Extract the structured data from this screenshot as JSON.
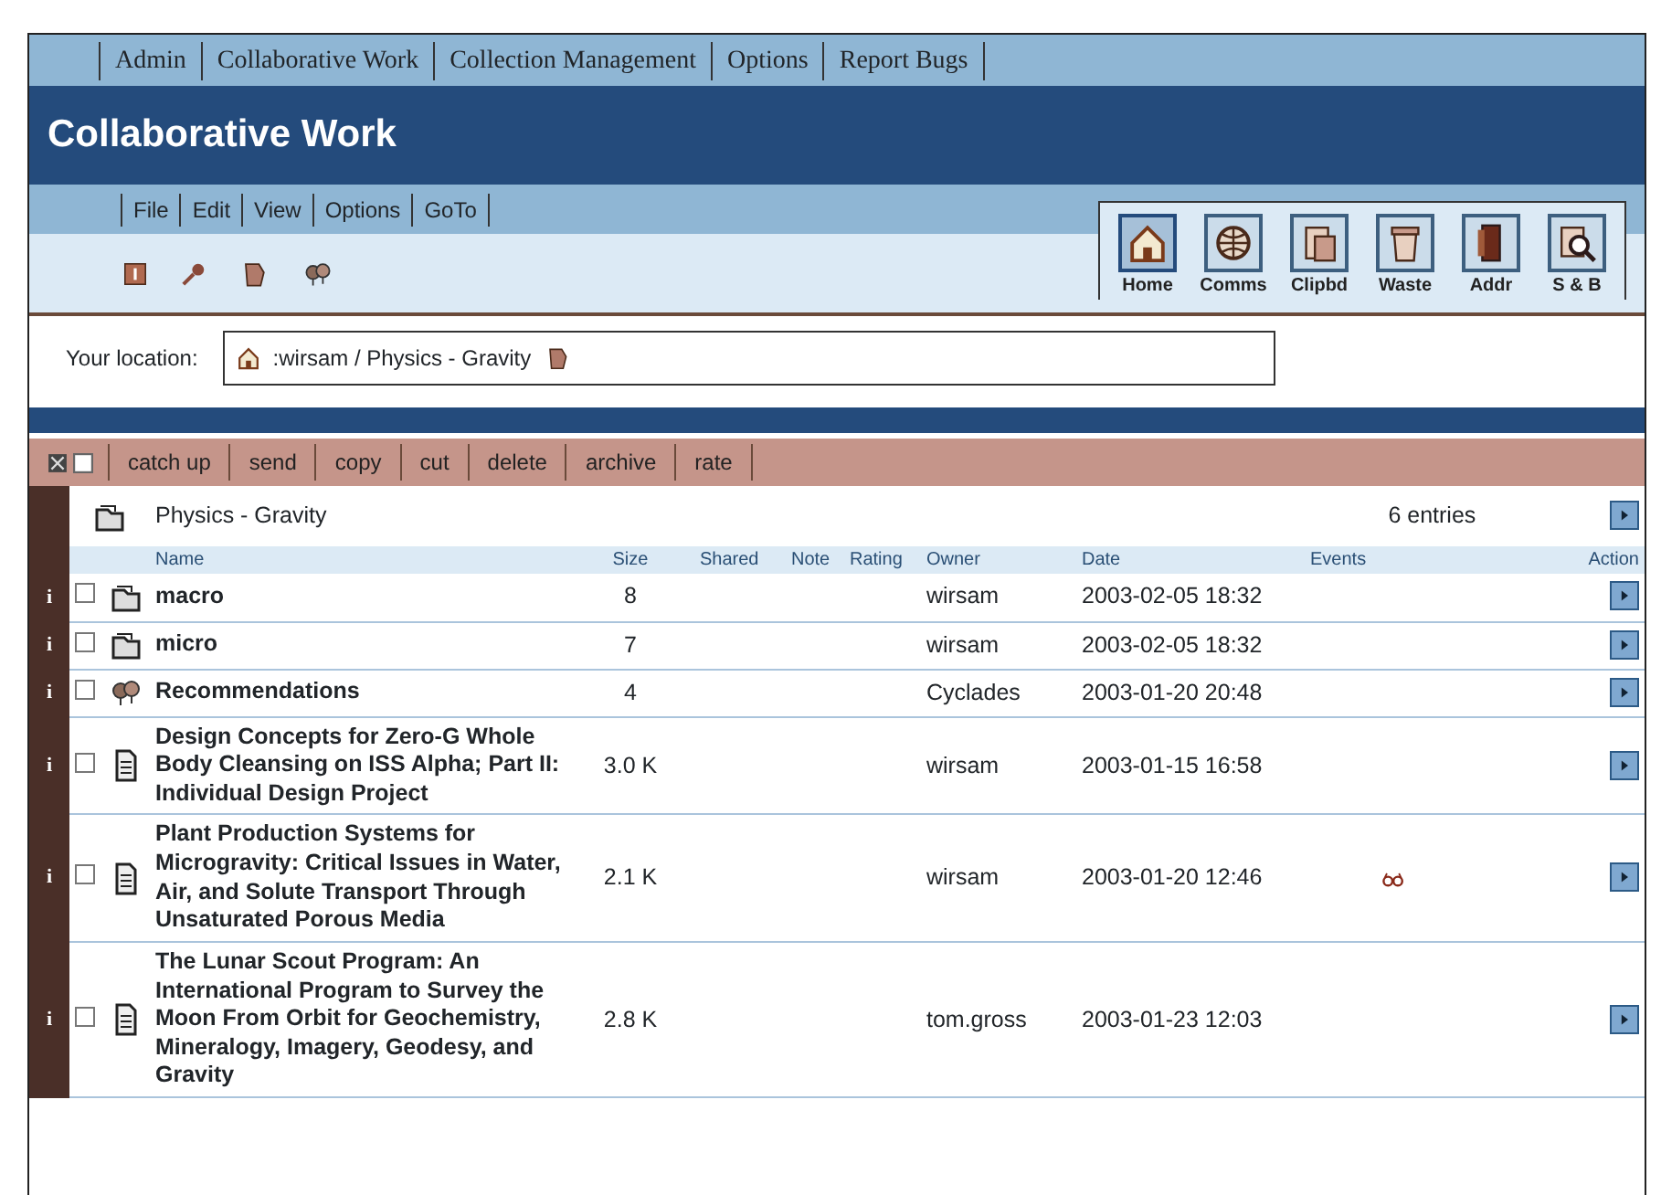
{
  "top_menu": [
    "Admin",
    "Collaborative Work",
    "Collection Management",
    "Options",
    "Report Bugs"
  ],
  "title": "Collaborative Work",
  "menu": [
    "File",
    "Edit",
    "View",
    "Options",
    "GoTo"
  ],
  "nav_buttons": [
    {
      "label": "Home",
      "kind": "home",
      "selected": true
    },
    {
      "label": "Comms",
      "kind": "comms",
      "selected": false
    },
    {
      "label": "Clipbd",
      "kind": "clipbd",
      "selected": false
    },
    {
      "label": "Waste",
      "kind": "waste",
      "selected": false
    },
    {
      "label": "Addr",
      "kind": "addr",
      "selected": false
    },
    {
      "label": "S & B",
      "kind": "search",
      "selected": false
    }
  ],
  "location": {
    "label": "Your location:",
    "path": ":wirsam / Physics - Gravity"
  },
  "actions": [
    "catch up",
    "send",
    "copy",
    "cut",
    "delete",
    "archive",
    "rate"
  ],
  "folder": {
    "name": "Physics - Gravity",
    "count": "6 entries"
  },
  "columns": [
    "Name",
    "Size",
    "Shared",
    "Note",
    "Rating",
    "Owner",
    "Date",
    "Events",
    "Action"
  ],
  "rows": [
    {
      "info": "i",
      "kind": "folder",
      "checked": false,
      "name": "macro",
      "size": "8",
      "owner": "wirsam",
      "date": "2003-02-05 18:32",
      "event": false
    },
    {
      "info": "i",
      "kind": "folder",
      "checked": false,
      "name": "micro",
      "size": "7",
      "owner": "wirsam",
      "date": "2003-02-05 18:32",
      "event": false
    },
    {
      "info": "i",
      "kind": "recommendations",
      "checked": false,
      "name": "Recommendations",
      "size": "4",
      "owner": "Cyclades",
      "date": "2003-01-20 20:48",
      "event": false
    },
    {
      "info": "i",
      "kind": "document",
      "checked": false,
      "name": "Design Concepts for Zero-G Whole Body Cleansing on ISS Alpha; Part II: Individual Design Project",
      "size": "3.0 K",
      "owner": "wirsam",
      "date": "2003-01-15 16:58",
      "event": false
    },
    {
      "info": "i",
      "kind": "document",
      "checked": false,
      "name": "Plant Production Systems for Microgravity: Critical Issues in Water, Air, and Solute Transport Through Unsaturated Porous Media",
      "size": "2.1 K",
      "owner": "wirsam",
      "date": "2003-01-20 12:46",
      "event": true
    },
    {
      "info": "i",
      "kind": "document",
      "checked": false,
      "name": "The Lunar Scout Program: An International Program to Survey the Moon From Orbit for Geochemistry, Mineralogy, Imagery, Geodesy, and Gravity",
      "size": "2.8 K",
      "owner": "tom.gross",
      "date": "2003-01-23 12:03",
      "event": false
    }
  ]
}
